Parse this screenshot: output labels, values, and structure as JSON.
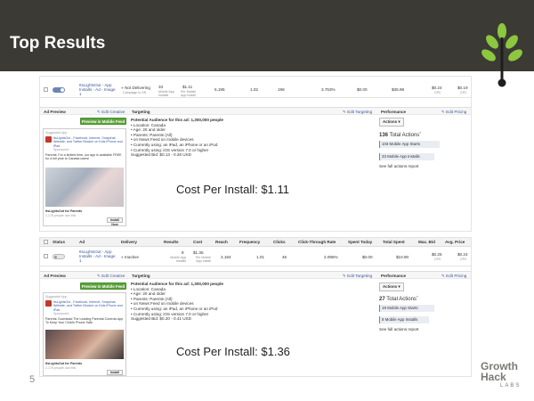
{
  "slide": {
    "title": "Top Results",
    "number": "5",
    "brand": {
      "line1": "Growth",
      "line2": "Hack",
      "line3": "LABS"
    }
  },
  "ad1": {
    "row": {
      "name": "ItsLightsOut - App Installs - Ad - Image 1",
      "delivery": "Not Delivering",
      "delivery_sub": "Campaign is Off",
      "results": "33",
      "results_sub": "Mobile App Installs",
      "cost": "$1.11",
      "cost_sub": "Per Mobile App Install",
      "reach": "5,195",
      "frequency": "1.02",
      "clicks": "198",
      "ctr": "3.753%",
      "spent_today": "$0.00",
      "total_spent": "$36.89",
      "max_bid": "$0.24",
      "max_bid_sub": "CPC",
      "avg_price": "$0.19",
      "avg_price_sub": "CPC"
    },
    "sections": {
      "ad_preview": "Ad Preview",
      "edit_creative": "✎ Edit Creative",
      "targeting": "Targeting",
      "edit_targeting": "✎ Edit Targeting",
      "performance": "Performance",
      "edit_pricing": "✎ Edit Pricing"
    },
    "preview_button": "Preview in Mobile Feed",
    "mock": {
      "suggested": "Suggested App",
      "page": "ItsLightsOut - Facebook, Internet, Snapchat, Website, and Twitter Blocker on Kids iPhone and iPad",
      "sponsored": "Sponsored",
      "body": "Parents: For a limited time, our app is available FREE for a full year to Canada users!",
      "app_name": "ItsLightsOut for Parents",
      "app_sub": "2,178 people use this",
      "install": "Install Now"
    },
    "targeting": {
      "audience": "Potential Audience for this ad: 1,300,000 people",
      "items": [
        "Location: Canada",
        "Age: 20 and older",
        "Parents: Parents (All)",
        "on News Feed on mobile devices",
        "Currently using: an iPad, an iPhone or an iPod",
        "Currently using: iOS version 7.0 or higher"
      ],
      "bid": "Suggested Bid: $0.13 - 0.28 USD"
    },
    "performance": {
      "actions_btn": "Actions ▾",
      "total_count": "136",
      "total_label": "Total Actions",
      "metrics": [
        "103 Mobile App Starts",
        "33 Mobile App Installs"
      ],
      "report_link": "See full actions report"
    },
    "caption": "Cost Per Install: $1.11"
  },
  "ad2": {
    "headers": [
      "Status",
      "Ad",
      "Delivery",
      "Results",
      "Cost",
      "Reach",
      "Frequency",
      "Clicks",
      "Click-Through Rate",
      "Spent Today",
      "Total Spent",
      "Max. Bid",
      "Avg. Price"
    ],
    "row": {
      "name": "ItsLightsOut - App Installs - Ad - Image 1",
      "delivery": "Inactive",
      "results": "8",
      "results_sub": "Mobile App Installs",
      "cost": "$1.36",
      "cost_sub": "Per Mobile App Install",
      "reach": "2,184",
      "frequency": "1.01",
      "clicks": "46",
      "ctr": "2.095%",
      "spent_today": "$0.00",
      "total_spent": "$10.90",
      "max_bid": "$0.25",
      "max_bid_sub": "CPC",
      "avg_price": "$0.24",
      "avg_price_sub": "CPC"
    },
    "sections": {
      "ad_preview": "Ad Preview",
      "edit_creative": "✎ Edit Creative",
      "targeting": "Targeting",
      "edit_targeting": "✎ Edit Targeting",
      "performance": "Performance",
      "edit_pricing": "✎ Edit Pricing"
    },
    "preview_button": "Preview in Mobile Feed",
    "mock": {
      "suggested": "Suggested App",
      "page": "ItsLightsOut - Facebook, Internet, Snapchat, Website, and Twitter Blocker on Kids iPhone and iPad",
      "sponsored": "Sponsored",
      "body": "Parents: Download The Leading Parental Controls App To Keep Your Child's Phone Safe.",
      "app_name": "ItsLightsOut for Parents",
      "app_sub": "2,178 people use this",
      "install": "Install Now"
    },
    "targeting": {
      "audience": "Potential Audience for this ad: 1,300,000 people",
      "items": [
        "Location: Canada",
        "Age: 20 and older",
        "Parents: Parents (All)",
        "on News Feed on mobile devices",
        "Currently using: an iPad, an iPhone or an iPod",
        "Currently using: iOS version 7.0 or higher"
      ],
      "bid": "Suggested Bid: $0.20 - 0.41 USD"
    },
    "performance": {
      "actions_btn": "Actions ▾",
      "total_count": "27",
      "total_label": "Total Actions",
      "metrics": [
        "19 Mobile App Starts",
        "8 Mobile App Installs"
      ],
      "report_link": "See full actions report"
    },
    "caption": "Cost Per Install: $1.36"
  },
  "colors": {
    "header_bg": "#3b3a35",
    "leaf_green": "#8dc63f",
    "fb_blue": "#3b5998",
    "button_green": "#5aa33b"
  }
}
